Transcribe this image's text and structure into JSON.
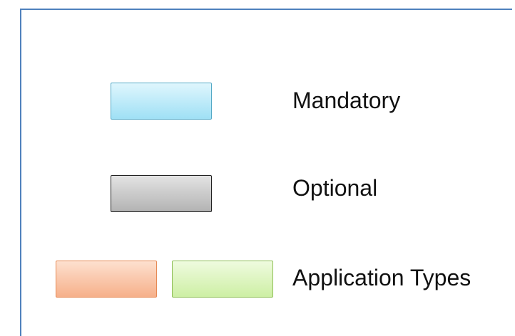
{
  "legend": {
    "items": [
      {
        "label": "Mandatory",
        "swatches": [
          {
            "fill_top": "#dff6fd",
            "fill_bottom": "#9fe0f5",
            "border": "#55a9c6"
          }
        ]
      },
      {
        "label": "Optional",
        "swatches": [
          {
            "fill_top": "#e3e3e3",
            "fill_bottom": "#b3b3b3",
            "border": "#222222"
          }
        ]
      },
      {
        "label": "Application Types",
        "swatches": [
          {
            "fill_top": "#fde0cf",
            "fill_bottom": "#f6b08a",
            "border": "#e68a55"
          },
          {
            "fill_top": "#effbdf",
            "fill_bottom": "#cdefa4",
            "border": "#8fbf57"
          }
        ]
      }
    ],
    "frame_border_color": "#4f81bd"
  }
}
